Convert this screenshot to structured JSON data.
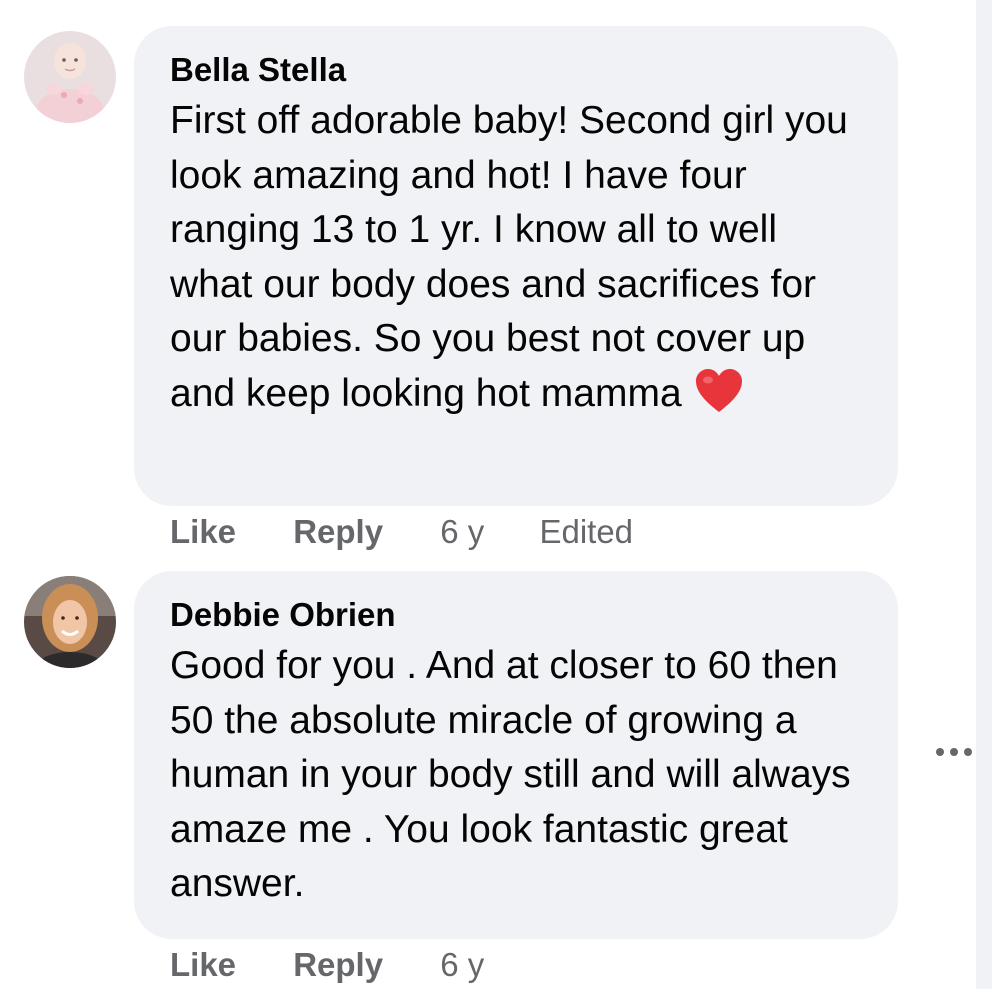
{
  "comments": [
    {
      "author": "Bella Stella",
      "text": "First off adorable baby! Second girl you look amazing and hot! I have four ranging 13 to 1 yr. I know all to well what our body does and sacrifices for our babies. So you best not cover up and keep looking hot mamma",
      "emoji": "heart-emoji",
      "actions": {
        "like": "Like",
        "reply": "Reply",
        "time": "6 y",
        "edited": "Edited"
      }
    },
    {
      "author": "Debbie Obrien",
      "text": "Good for you . And at closer to 60 then 50 the absolute miracle of growing a human in your body still and will always amaze me . You look fantastic great answer.",
      "actions": {
        "like": "Like",
        "reply": "Reply",
        "time": "6 y"
      }
    }
  ],
  "more_options_icon": "more-horizontal-icon",
  "colors": {
    "bubble": "#f0f2f5",
    "text": "#050505",
    "secondary": "#65676b",
    "heart": "#e8343b"
  }
}
